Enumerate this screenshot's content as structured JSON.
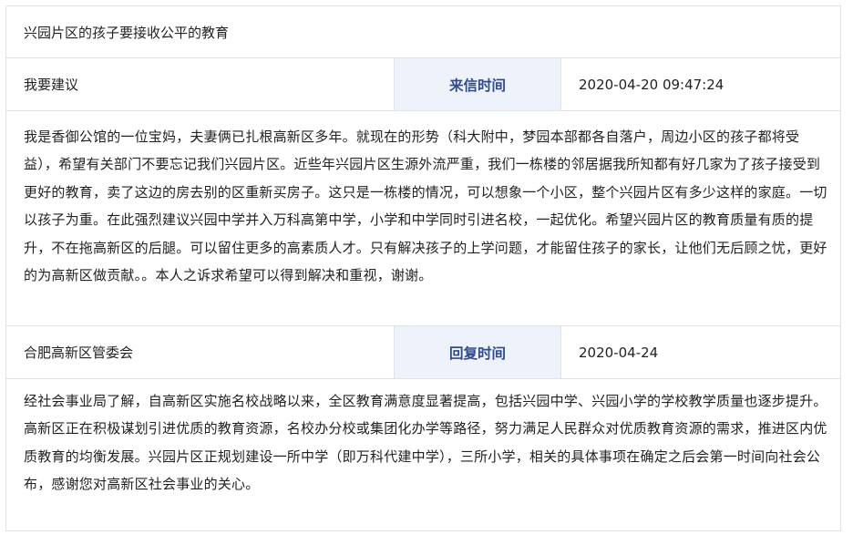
{
  "letter": {
    "title": "兴园片区的孩子要接收公平的教育",
    "sender": "我要建议",
    "sent_label": "来信时间",
    "sent_time": "2020-04-20 09:47:24",
    "content": "我是香御公馆的一位宝妈，夫妻俩已扎根高新区多年。就现在的形势（科大附中，梦园本部都各自落户，周边小区的孩子都将受益），希望有关部门不要忘记我们兴园片区。近些年兴园片区生源外流严重，我们一栋楼的邻居据我所知都有好几家为了孩子接受到更好的教育，卖了这边的房去别的区重新买房子。这只是一栋楼的情况，可以想象一个小区，整个兴园片区有多少这样的家庭。一切以孩子为重。在此强烈建议兴园中学并入万科高第中学，小学和中学同时引进名校，一起优化。希望兴园片区的教育质量有质的提升，不在拖高新区的后腿。可以留住更多的高素质人才。只有解决孩子的上学问题，才能留住孩子的家长，让他们无后顾之忧，更好的为高新区做贡献。。本人之诉求希望可以得到解决和重视，谢谢。"
  },
  "reply": {
    "responder": "合肥高新区管委会",
    "reply_label": "回复时间",
    "reply_time": "2020-04-24",
    "content": "经社会事业局了解，自高新区实施名校战略以来，全区教育满意度显著提高，包括兴园中学、兴园小学的学校教学质量也逐步提升。高新区正在积极谋划引进优质的教育资源，名校办分校或集团化办学等路径，努力满足人民群众对优质教育资源的需求，推进区内优质教育的均衡发展。兴园片区正规划建设一所中学（即万科代建中学），三所小学，相关的具体事项在确定之后会第一时间向社会公布，感谢您对高新区社会事业的关心。"
  }
}
